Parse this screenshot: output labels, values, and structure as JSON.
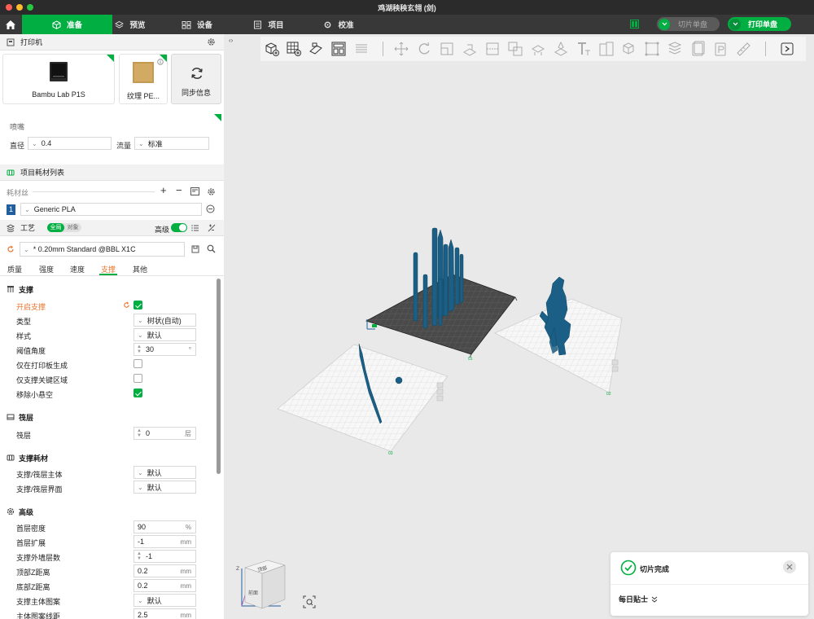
{
  "window": {
    "title": "鸡湖秧秧玄翎 (剑)"
  },
  "nav": {
    "tabs": [
      {
        "label": "准备",
        "icon": "cube-icon"
      },
      {
        "label": "预览",
        "icon": "layers-icon"
      },
      {
        "label": "设备",
        "icon": "device-icon"
      },
      {
        "label": "项目",
        "icon": "document-icon"
      },
      {
        "label": "校准",
        "icon": "calibrate-icon"
      }
    ],
    "slice_label": "切片单盘",
    "print_label": "打印单盘"
  },
  "printer": {
    "section_title": "打印机",
    "printer_name": "Bambu Lab P1S",
    "plate_name": "纹理 PE...",
    "sync_label": "同步信息",
    "nozzle_title": "喷嘴",
    "diameter_label": "直径",
    "diameter_value": "0.4",
    "flow_label": "流量",
    "flow_value": "标准"
  },
  "filament": {
    "section_title": "项目耗材列表",
    "sub_label": "耗材丝",
    "slot_number": "1",
    "material": "Generic PLA"
  },
  "process": {
    "title": "工艺",
    "toggle_global": "全局",
    "toggle_object": "对象",
    "advanced_label": "高级",
    "preset": "* 0.20mm Standard @BBL X1C",
    "subtabs": [
      "质量",
      "强度",
      "速度",
      "支撑",
      "其他"
    ],
    "active_subtab": "支撑"
  },
  "support": {
    "group": "支撑",
    "enable_label": "开启支撑",
    "enable_checked": true,
    "type_label": "类型",
    "type_value": "树状(自动)",
    "style_label": "样式",
    "style_value": "默认",
    "threshold_label": "阈值角度",
    "threshold_value": "30",
    "threshold_unit": "°",
    "buildplate_only_label": "仅在打印板生成",
    "buildplate_only_checked": false,
    "critical_only_label": "仅支撑关键区域",
    "critical_only_checked": false,
    "remove_small_label": "移除小悬空",
    "remove_small_checked": true
  },
  "raft": {
    "group": "筏层",
    "layers_label": "筏层",
    "layers_value": "0",
    "layers_unit": "层"
  },
  "support_filament": {
    "group": "支撑耗材",
    "base_label": "支撑/筏层主体",
    "base_value": "默认",
    "interface_label": "支撑/筏层界面",
    "interface_value": "默认"
  },
  "advanced": {
    "group": "高级",
    "first_density_label": "首层密度",
    "first_density_value": "90",
    "first_density_unit": "%",
    "first_expansion_label": "首层扩展",
    "first_expansion_value": "-1",
    "first_expansion_unit": "mm",
    "wall_loops_label": "支撑外墙层数",
    "wall_loops_value": "-1",
    "top_z_label": "顶部Z距离",
    "top_z_value": "0.2",
    "top_z_unit": "mm",
    "bottom_z_label": "底部Z距离",
    "bottom_z_value": "0.2",
    "bottom_z_unit": "mm",
    "base_pattern_label": "支撑主体图案",
    "base_pattern_value": "默认",
    "pattern_spacing_label": "主体图案线距",
    "pattern_spacing_value": "2.5",
    "pattern_spacing_unit": "mm"
  },
  "viewport": {
    "plate_labels": [
      "01",
      "02",
      "03"
    ],
    "cube_top": "顶部",
    "cube_front": "前面",
    "axis_z": "Z"
  },
  "toast": {
    "status": "切片完成",
    "tip_label": "每日贴士"
  },
  "colors": {
    "accent": "#00ae42",
    "model": "#1b5f86",
    "nav": "#383838"
  }
}
